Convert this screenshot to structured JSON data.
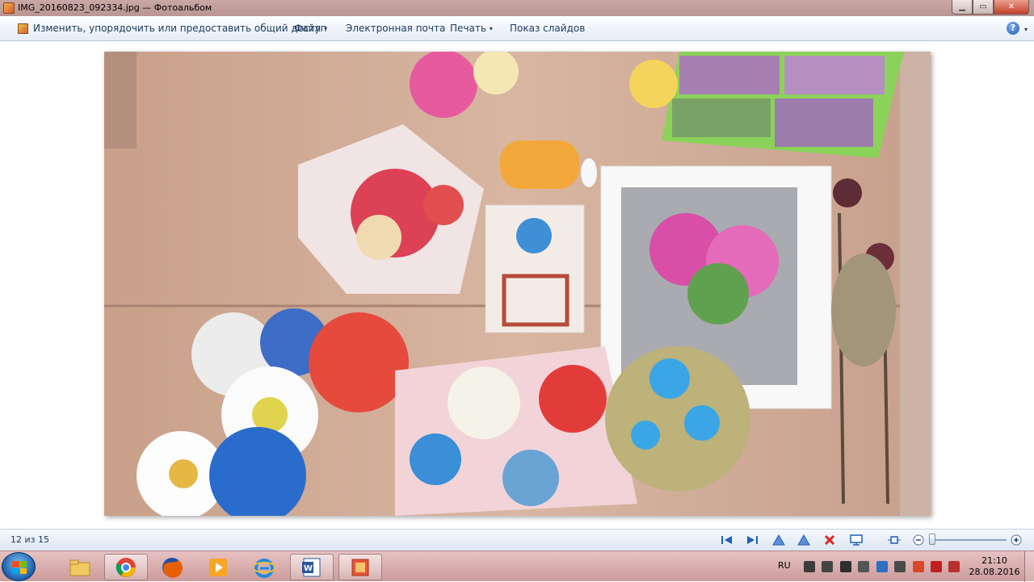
{
  "window": {
    "title": "IMG_20160823_092334.jpg — Фотоальбом",
    "minimize_glyph": "▁",
    "maximize_glyph": "▭",
    "close_glyph": "✕"
  },
  "commandbar": {
    "share_label": "Изменить, упорядочить или предоставить общий доступ",
    "file_label": "Файл",
    "email_label": "Электронная почта",
    "print_label": "Печать",
    "slideshow_label": "Показ слайдов",
    "caret": "▾",
    "help_glyph": "?"
  },
  "status": {
    "counter": "12 из 15"
  },
  "taskbar": {
    "language": "RU",
    "time": "21:10",
    "date": "28.08.2016",
    "items": [
      {
        "name": "explorer-icon"
      },
      {
        "name": "chrome-icon"
      },
      {
        "name": "firefox-icon"
      },
      {
        "name": "media-player-icon"
      },
      {
        "name": "internet-explorer-icon"
      },
      {
        "name": "word-icon"
      },
      {
        "name": "photo-gallery-icon",
        "active": true
      }
    ]
  },
  "colors": {
    "accent": "#1e395b",
    "delete_red": "#d9241c",
    "control_blue": "#1f5fb8"
  }
}
